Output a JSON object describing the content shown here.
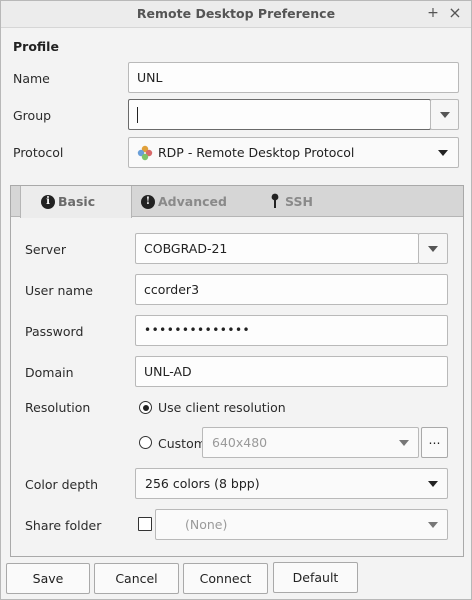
{
  "window": {
    "title": "Remote Desktop Preference",
    "maximize_glyph": "+",
    "close_glyph": "×"
  },
  "profile": {
    "section_title": "Profile",
    "name_label": "Name",
    "name_value": "UNL",
    "group_label": "Group",
    "group_value": "",
    "protocol_label": "Protocol",
    "protocol_value": "RDP - Remote Desktop Protocol"
  },
  "tabs": [
    {
      "label": "Basic",
      "icon": "info-icon",
      "active": true
    },
    {
      "label": "Advanced",
      "icon": "exclamation-icon",
      "active": false
    },
    {
      "label": "SSH",
      "icon": "key-icon",
      "active": false
    }
  ],
  "basic": {
    "server_label": "Server",
    "server_value": "COBGRAD-21",
    "username_label": "User name",
    "username_value": "ccorder3",
    "password_label": "Password",
    "password_value": "••••••••••••••",
    "domain_label": "Domain",
    "domain_value": "UNL-AD",
    "resolution_label": "Resolution",
    "resolution_client_label": "Use client resolution",
    "resolution_custom_label": "Custom",
    "resolution_custom_value": "640x480",
    "resolution_more": "...",
    "resolution_selected": "client",
    "colordepth_label": "Color depth",
    "colordepth_value": "256 colors (8 bpp)",
    "share_label": "Share folder",
    "share_checked": false,
    "share_value": "(None)"
  },
  "buttons": {
    "save": "Save",
    "cancel": "Cancel",
    "connect": "Connect",
    "default": "Default"
  }
}
